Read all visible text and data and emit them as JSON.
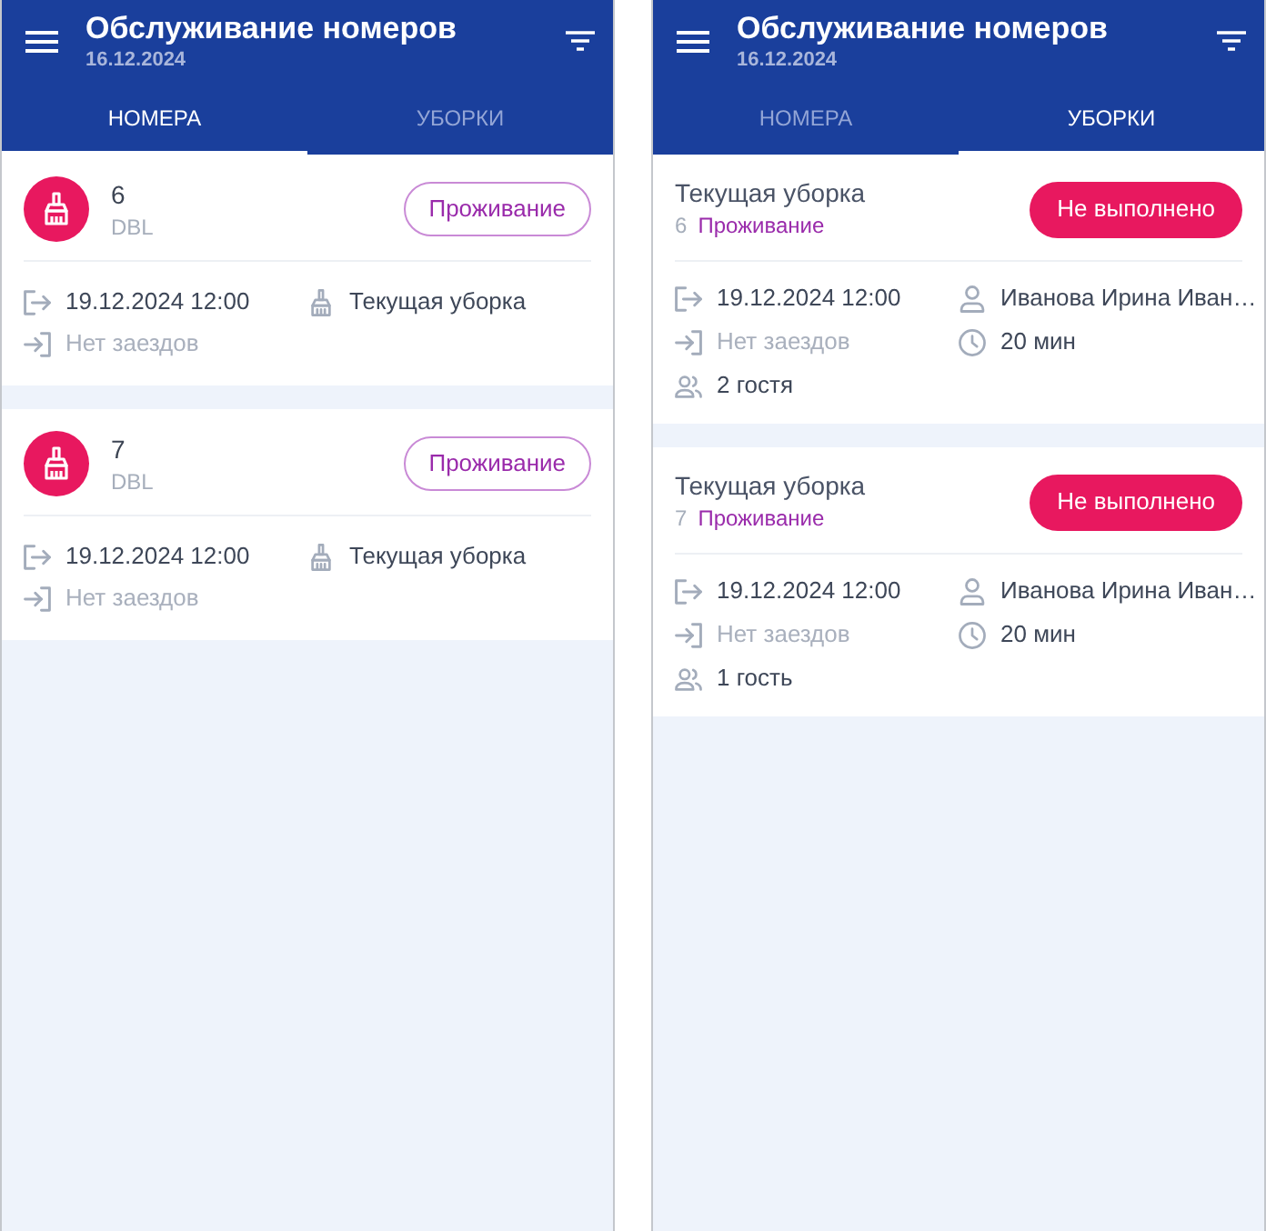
{
  "screens": [
    {
      "header": {
        "title": "Обслуживание номеров",
        "date": "16.12.2024"
      },
      "tabs": [
        {
          "label": "НОМЕРА",
          "selected": true
        },
        {
          "label": "УБОРКИ",
          "selected": false
        }
      ],
      "cards": [
        {
          "kind": "room",
          "number": "6",
          "room_type": "DBL",
          "status": "Проживание",
          "details": [
            {
              "kind": "departure",
              "text": "19.12.2024 12:00",
              "dimmed": false
            },
            {
              "kind": "cleaning",
              "text": "Текущая уборка",
              "dimmed": false
            },
            {
              "kind": "arrival",
              "text": "Нет заездов",
              "dimmed": true
            }
          ]
        },
        {
          "kind": "room",
          "number": "7",
          "room_type": "DBL",
          "status": "Проживание",
          "details": [
            {
              "kind": "departure",
              "text": "19.12.2024 12:00",
              "dimmed": false
            },
            {
              "kind": "cleaning",
              "text": "Текущая уборка",
              "dimmed": false
            },
            {
              "kind": "arrival",
              "text": "Нет заездов",
              "dimmed": true
            }
          ]
        }
      ]
    },
    {
      "header": {
        "title": "Обслуживание номеров",
        "date": "16.12.2024"
      },
      "tabs": [
        {
          "label": "НОМЕРА",
          "selected": false
        },
        {
          "label": "УБОРКИ",
          "selected": true
        }
      ],
      "cards": [
        {
          "kind": "cleaning",
          "title": "Текущая уборка",
          "number": "6",
          "status": "Проживание",
          "badge": "Не выполнено",
          "details": [
            {
              "kind": "departure",
              "text": "19.12.2024 12:00",
              "dimmed": false
            },
            {
              "kind": "assignee",
              "text": "Иванова Ирина Иван…",
              "dimmed": false
            },
            {
              "kind": "arrival",
              "text": "Нет заездов",
              "dimmed": true
            },
            {
              "kind": "duration",
              "text": "20 мин",
              "dimmed": false
            },
            {
              "kind": "guests",
              "text": "2 гостя",
              "dimmed": false
            }
          ]
        },
        {
          "kind": "cleaning",
          "title": "Текущая уборка",
          "number": "7",
          "status": "Проживание",
          "badge": "Не выполнено",
          "details": [
            {
              "kind": "departure",
              "text": "19.12.2024 12:00",
              "dimmed": false
            },
            {
              "kind": "assignee",
              "text": "Иванова Ирина Иван…",
              "dimmed": false
            },
            {
              "kind": "arrival",
              "text": "Нет заездов",
              "dimmed": true
            },
            {
              "kind": "duration",
              "text": "20 мин",
              "dimmed": false
            },
            {
              "kind": "guests",
              "text": "1 гость",
              "dimmed": false
            }
          ]
        }
      ]
    }
  ]
}
